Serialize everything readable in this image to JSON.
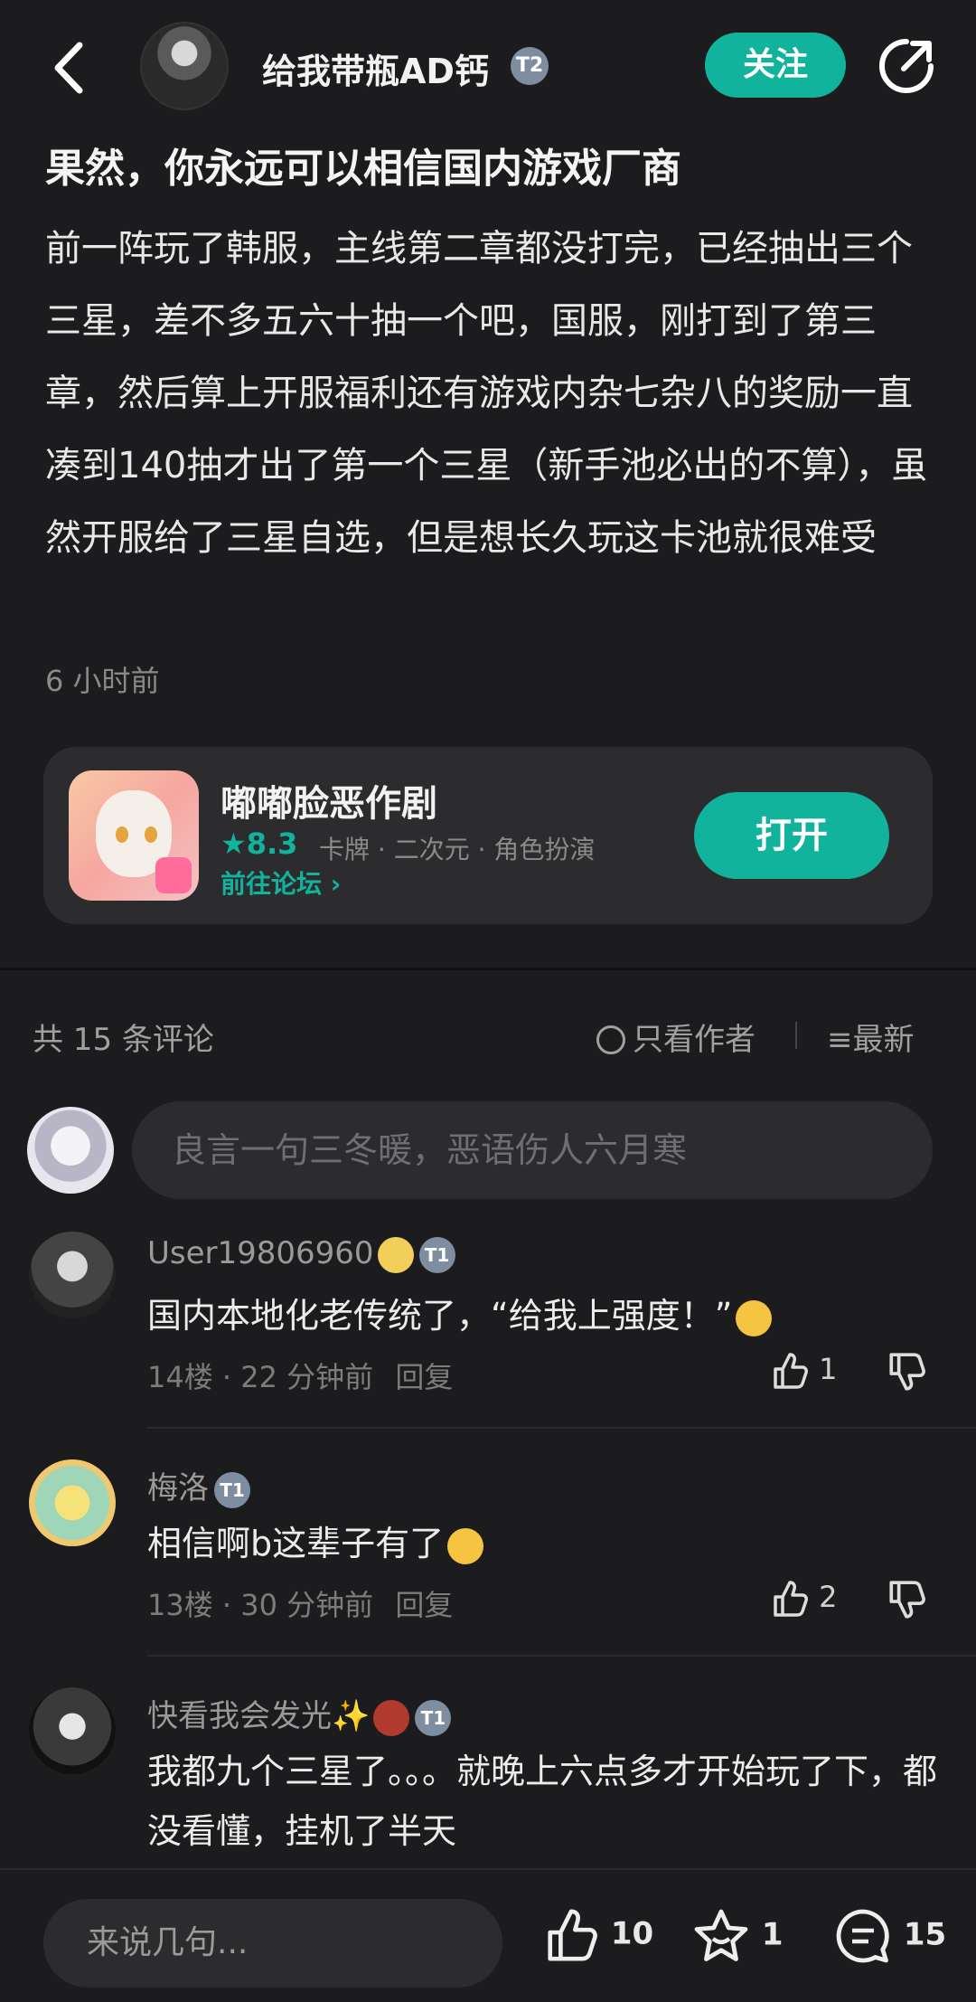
{
  "header": {
    "author_name": "给我带瓶AD钙",
    "author_badge": "T2",
    "follow_label": "关注"
  },
  "post": {
    "title": "果然，你永远可以相信国内游戏厂商",
    "body": "前一阵玩了韩服，主线第二章都没打完，已经抽出三个三星，差不多五六十抽一个吧，国服，刚打到了第三章，然后算上开服福利还有游戏内杂七杂八的奖励一直凑到140抽才出了第一个三星（新手池必出的不算），虽然开服给了三星自选，但是想长久玩这卡池就很难受",
    "time": "6 小时前"
  },
  "game_card": {
    "name": "嘟嘟脸恶作剧",
    "rating": "8.3",
    "tags": "卡牌 · 二次元 · 角色扮演",
    "forum_link": "前往论坛",
    "open_label": "打开"
  },
  "comments_section": {
    "count_label": "共 15 条评论",
    "author_only_label": "只看作者",
    "sort_label": "最新",
    "input_placeholder": "良言一句三冬暖，恶语伤人六月寒"
  },
  "comments": [
    {
      "user": "User19806960",
      "badge": "T1",
      "text": "国内本地化老传统了，“给我上强度！”",
      "meta": "14楼 · 22 分钟前",
      "reply": "回复",
      "likes": "1"
    },
    {
      "user": "梅洛",
      "badge": "T1",
      "text": "相信啊b这辈子有了",
      "meta": "13楼 · 30 分钟前",
      "reply": "回复",
      "likes": "2"
    },
    {
      "user": "快看我会发光✨",
      "badge": "T1",
      "text": "我都九个三星了。。。就晚上六点多才开始玩了下，都没看懂，挂机了半天"
    }
  ],
  "bottom_bar": {
    "input_placeholder": "来说几句...",
    "likes": "10",
    "favorites": "1",
    "comments": "15"
  },
  "colors": {
    "accent": "#12b39d",
    "background": "#1c1c1e",
    "card": "#2c2c2e"
  }
}
